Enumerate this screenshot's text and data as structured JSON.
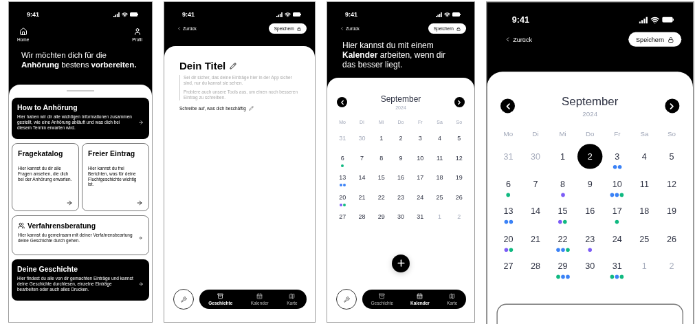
{
  "phones": [
    {
      "kind": "home",
      "time": "9:41",
      "nav": [
        {
          "label": "Home"
        },
        {
          "label": "Profil"
        }
      ],
      "headline": "Wir möchten dich für die **Anhörung** bestens **vorbereiten.**",
      "cards": [
        {
          "kind": "dark",
          "title": "How to Anhörung",
          "text": "Hier haben wir dir alle wichtigen Informationen zusammen gestellt, wie eine Anhörung abläuft und was dich bei diesem Termin erwarten wird."
        },
        {
          "kind": "half",
          "title": "Fragekatalog",
          "text": "Hier kannst du dir alle Fragen ansehen, die dich bei der Anhörung erwarten."
        },
        {
          "kind": "half",
          "title": "Freier Eintrag",
          "text": "Hier kannst du frei Berichten, was für deine Fluchtgeschichte wichtig ist."
        },
        {
          "kind": "group",
          "title": "Verfahrensberatung",
          "text": "Hier kannst du gemeinsam mit deiner Verfahrensbeartung deine Geschichte durch gehen."
        },
        {
          "kind": "dark",
          "title": "Deine Geschichte",
          "text": "Hier findest du alle von dir gemachten Einträge und kannst deine Geschichte durchlesen, einzelne Einträge bearbeiten oder auch alles Drucken."
        }
      ]
    },
    {
      "kind": "editor",
      "time": "9:41",
      "back": "Zurück",
      "save": "Speichern",
      "title": "Dein Titel",
      "hints": [
        "Sei dir sicher, das deine Einträge hier in der App sicher sind, nur du kannst sie sehen.",
        "Probiere auch unsere Tools aus, um einen noch besseren Eintrag zu schreiben."
      ],
      "prompt": "Schreibe auf, was dich beschäftig",
      "tabs": [
        {
          "label": "Geschichte",
          "selected": true
        },
        {
          "label": "Kalender",
          "selected": false
        },
        {
          "label": "Karte",
          "selected": false
        }
      ]
    },
    {
      "kind": "calendar",
      "time": "9:41",
      "back": "Zurück",
      "save": "Speichern",
      "intro": "Hier kannst du mit einem **Kalender** arbeiten, wenn dir das besser liegt.",
      "calendar": {
        "month": "September",
        "year": "2024",
        "weekdays": [
          "Mo",
          "Di",
          "Mi",
          "Do",
          "Fr",
          "Sa",
          "So"
        ],
        "days": [
          {
            "label": "31",
            "muted": true,
            "selected": false
          },
          {
            "label": "30",
            "muted": true,
            "selected": false
          },
          {
            "label": "1",
            "muted": false,
            "selected": false
          },
          {
            "label": "2",
            "muted": false,
            "selected": false
          },
          {
            "label": "3",
            "muted": false,
            "selected": false
          },
          {
            "label": "4",
            "muted": false,
            "selected": false
          },
          {
            "label": "5",
            "muted": false,
            "selected": false
          },
          {
            "label": "6",
            "muted": false,
            "selected": false,
            "dots": [
              {
                "color": "#10b981"
              }
            ]
          },
          {
            "label": "7",
            "muted": false,
            "selected": false
          },
          {
            "label": "8",
            "muted": false,
            "selected": false
          },
          {
            "label": "9",
            "muted": false,
            "selected": false
          },
          {
            "label": "10",
            "muted": false,
            "selected": false
          },
          {
            "label": "11",
            "muted": false,
            "selected": false
          },
          {
            "label": "12",
            "muted": false,
            "selected": false
          },
          {
            "label": "13",
            "muted": false,
            "selected": false,
            "dots": [
              {
                "color": "#3b82f6"
              },
              {
                "color": "#3b82f6"
              }
            ]
          },
          {
            "label": "14",
            "muted": false,
            "selected": false
          },
          {
            "label": "15",
            "muted": false,
            "selected": false
          },
          {
            "label": "16",
            "muted": false,
            "selected": false
          },
          {
            "label": "17",
            "muted": false,
            "selected": false
          },
          {
            "label": "18",
            "muted": false,
            "selected": false
          },
          {
            "label": "19",
            "muted": false,
            "selected": false
          },
          {
            "label": "20",
            "muted": false,
            "selected": false,
            "dots": [
              {
                "color": "#7c5cf6"
              },
              {
                "color": "#10b981"
              }
            ]
          },
          {
            "label": "21",
            "muted": false,
            "selected": false
          },
          {
            "label": "22",
            "muted": false,
            "selected": false
          },
          {
            "label": "23",
            "muted": false,
            "selected": false
          },
          {
            "label": "24",
            "muted": false,
            "selected": false
          },
          {
            "label": "25",
            "muted": false,
            "selected": false
          },
          {
            "label": "26",
            "muted": false,
            "selected": false
          },
          {
            "label": "27",
            "muted": false,
            "selected": false
          },
          {
            "label": "28",
            "muted": false,
            "selected": false
          },
          {
            "label": "29",
            "muted": false,
            "selected": false
          },
          {
            "label": "30",
            "muted": false,
            "selected": false
          },
          {
            "label": "31",
            "muted": false,
            "selected": false
          },
          {
            "label": "1",
            "muted": true,
            "selected": false
          },
          {
            "label": "2",
            "muted": true,
            "selected": false
          }
        ]
      },
      "tabs": [
        {
          "label": "Geschichte",
          "selected": false
        },
        {
          "label": "Kalender",
          "selected": true
        },
        {
          "label": "Karte",
          "selected": false
        }
      ]
    },
    {
      "kind": "calendar-zoom",
      "time": "9:41",
      "back": "Zurück",
      "save": "Speichern",
      "calendar": {
        "month": "September",
        "year": "2024",
        "weekdays": [
          "Mo",
          "Di",
          "Mi",
          "Do",
          "Fr",
          "Sa",
          "So"
        ],
        "days": [
          {
            "label": "31",
            "muted": true,
            "selected": false
          },
          {
            "label": "30",
            "muted": true,
            "selected": false
          },
          {
            "label": "1",
            "muted": false,
            "selected": false
          },
          {
            "label": "2",
            "muted": false,
            "selected": true
          },
          {
            "label": "3",
            "muted": false,
            "selected": false,
            "dots": [
              {
                "color": "#3b82f6"
              },
              {
                "color": "#3b82f6"
              }
            ]
          },
          {
            "label": "4",
            "muted": false,
            "selected": false
          },
          {
            "label": "5",
            "muted": false,
            "selected": false
          },
          {
            "label": "6",
            "muted": false,
            "selected": false,
            "dots": [
              {
                "color": "#10b981"
              }
            ]
          },
          {
            "label": "7",
            "muted": false,
            "selected": false
          },
          {
            "label": "8",
            "muted": false,
            "selected": false,
            "dots": [
              {
                "color": "#7c5cf6"
              }
            ]
          },
          {
            "label": "9",
            "muted": false,
            "selected": false
          },
          {
            "label": "10",
            "muted": false,
            "selected": false,
            "dots": [
              {
                "color": "#3b82f6"
              },
              {
                "color": "#3b82f6"
              },
              {
                "color": "#10b981"
              }
            ]
          },
          {
            "label": "11",
            "muted": false,
            "selected": false
          },
          {
            "label": "12",
            "muted": false,
            "selected": false
          },
          {
            "label": "13",
            "muted": false,
            "selected": false,
            "dots": [
              {
                "color": "#3b82f6"
              },
              {
                "color": "#3b82f6"
              }
            ]
          },
          {
            "label": "14",
            "muted": false,
            "selected": false
          },
          {
            "label": "15",
            "muted": false,
            "selected": false,
            "dots": [
              {
                "color": "#7c5cf6"
              },
              {
                "color": "#10b981"
              }
            ]
          },
          {
            "label": "16",
            "muted": false,
            "selected": false
          },
          {
            "label": "17",
            "muted": false,
            "selected": false,
            "dots": [
              {
                "color": "#10b981"
              }
            ]
          },
          {
            "label": "18",
            "muted": false,
            "selected": false
          },
          {
            "label": "19",
            "muted": false,
            "selected": false
          },
          {
            "label": "20",
            "muted": false,
            "selected": false,
            "dots": [
              {
                "color": "#7c5cf6"
              },
              {
                "color": "#10b981"
              }
            ]
          },
          {
            "label": "21",
            "muted": false,
            "selected": false
          },
          {
            "label": "22",
            "muted": false,
            "selected": false,
            "dots": [
              {
                "color": "#3b82f6"
              },
              {
                "color": "#3b82f6"
              },
              {
                "color": "#10b981"
              }
            ]
          },
          {
            "label": "23",
            "muted": false,
            "selected": false,
            "dots": [
              {
                "color": "#7c5cf6"
              }
            ]
          },
          {
            "label": "24",
            "muted": false,
            "selected": false
          },
          {
            "label": "25",
            "muted": false,
            "selected": false
          },
          {
            "label": "26",
            "muted": false,
            "selected": false
          },
          {
            "label": "27",
            "muted": false,
            "selected": false
          },
          {
            "label": "28",
            "muted": false,
            "selected": false
          },
          {
            "label": "29",
            "muted": false,
            "selected": false,
            "dots": [
              {
                "color": "#10b981"
              },
              {
                "color": "#3b82f6"
              },
              {
                "color": "#3b82f6"
              }
            ]
          },
          {
            "label": "30",
            "muted": false,
            "selected": false
          },
          {
            "label": "31",
            "muted": false,
            "selected": false,
            "dots": [
              {
                "color": "#10b981"
              },
              {
                "color": "#3b82f6"
              },
              {
                "color": "#10b981"
              }
            ]
          },
          {
            "label": "1",
            "muted": true,
            "selected": false
          },
          {
            "label": "2",
            "muted": true,
            "selected": false
          }
        ]
      }
    }
  ]
}
